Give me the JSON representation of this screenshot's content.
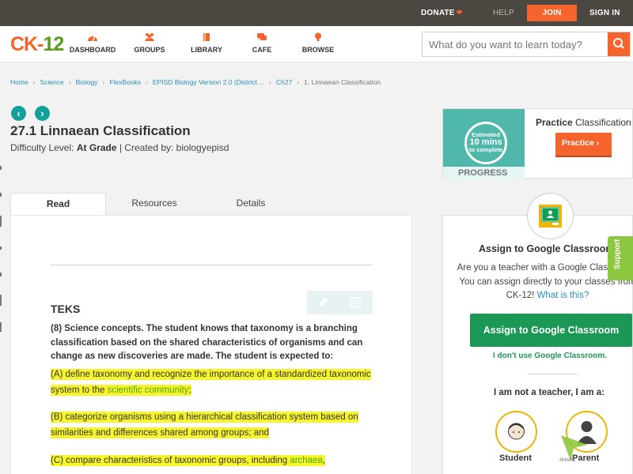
{
  "topbar": {
    "donate": "DONATE",
    "help": "HELP",
    "join": "JOIN",
    "signin": "SIGN IN"
  },
  "header": {
    "logo_ck": "CK",
    "logo_dash": "-",
    "logo_num": "12",
    "nav": [
      {
        "label": "DASHBOARD",
        "icon": "dashboard-icon"
      },
      {
        "label": "GROUPS",
        "icon": "groups-icon"
      },
      {
        "label": "LIBRARY",
        "icon": "library-icon"
      },
      {
        "label": "CAFE",
        "icon": "cafe-icon"
      },
      {
        "label": "BROWSE",
        "icon": "browse-icon"
      }
    ],
    "search_placeholder": "What do you want to learn today?"
  },
  "breadcrumb": [
    "Home",
    "Science",
    "Biology",
    "FlexBooks",
    "EPISD Biology Version 2.0 (District ...",
    "Ch27",
    "1. Linnaean Classification"
  ],
  "article": {
    "title": "27.1 Linnaean Classification",
    "difficulty_label": "Difficulty Level:",
    "difficulty_value": "At Grade",
    "created_by": "| Created by: biologyepisd"
  },
  "tabs": [
    "Read",
    "Resources",
    "Details"
  ],
  "content": {
    "heading": "TEKS",
    "concept": "(8)  Science concepts. The student knows that taxonomy is a branching classification based on the shared characteristics of organisms and can change as new discoveries are made. The student is expected to:",
    "a_text": "(A)  define taxonomy and recognize the importance of a standardized taxonomic system to the ",
    "a_link": "scientific community",
    "a_end": ";",
    "b_text": "(B)  categorize organisms using a hierarchical classification system based on similarities and differences shared among groups; and",
    "c_text": "(C)  compare characteristics of taxonomic groups, including ",
    "c_link": "archaea",
    "c_end": ","
  },
  "practice": {
    "estimated": "Estimated",
    "minutes": "10 mins",
    "to_complete": "to complete",
    "progress": "PROGRESS",
    "title_bold": "Practice",
    "title_rest": " Classification",
    "button": "Practice"
  },
  "classroom": {
    "title": "Assign to Google Classroom",
    "desc": "Are you a teacher with a Google Classroom? You can assign directly to your classes from CK-12! ",
    "desc_link": "What is this?",
    "button": "Assign to Google Classroom",
    "no_classroom": "I don't use Google Classroom.",
    "not_teacher": "I am not a teacher, I am a:",
    "roles": [
      "Student",
      "Parent"
    ]
  },
  "support": "Support",
  "share": "SHARE",
  "colors": {
    "brand_orange": "#f4642c",
    "brand_green": "#5c9a1e",
    "classroom_green": "#1b9855",
    "highlight": "#f7f52a",
    "teal": "#12a09b"
  }
}
